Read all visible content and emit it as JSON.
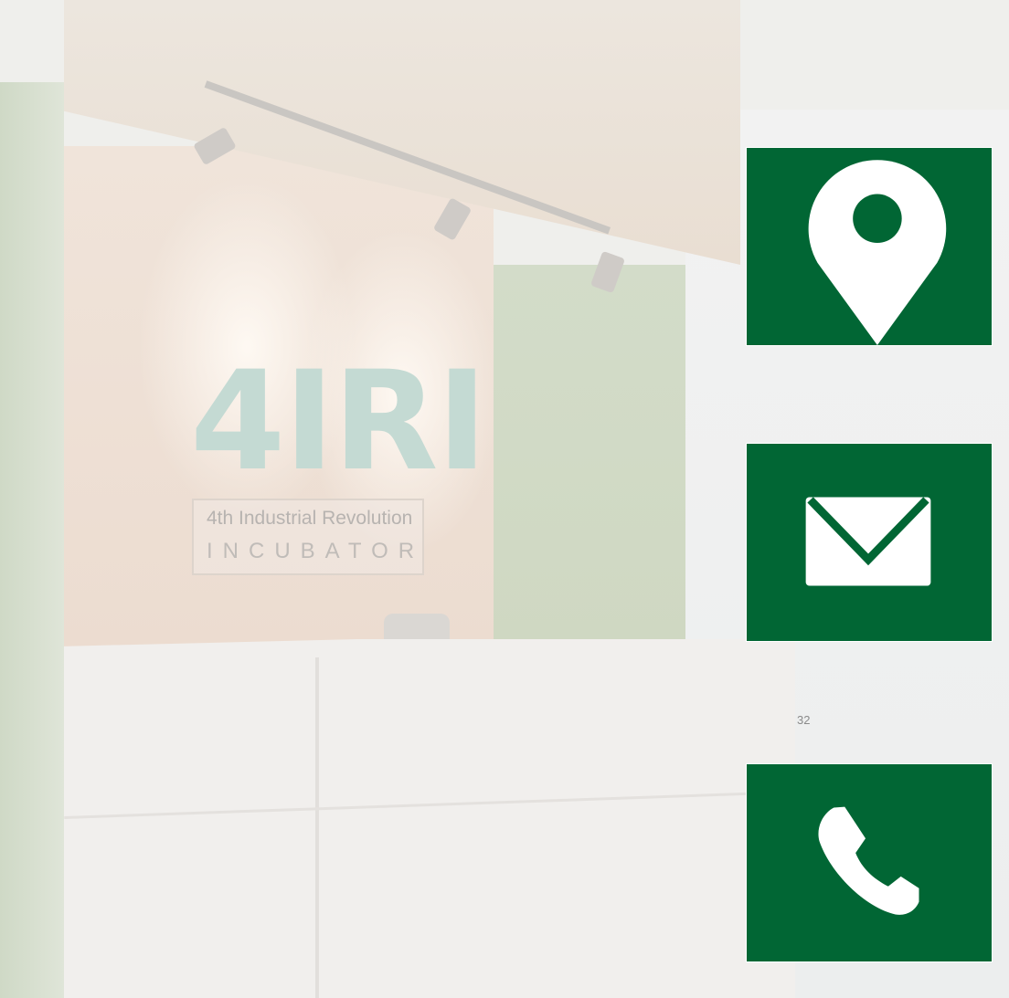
{
  "slide": {
    "page_number": "32",
    "background": {
      "sign": {
        "logo_text": "4IRI",
        "line1": "4th Industrial Revolution",
        "line2": "INCUBATOR"
      }
    },
    "contact_tiles": [
      {
        "icon": "location-pin-icon"
      },
      {
        "icon": "envelope-icon"
      },
      {
        "icon": "phone-icon"
      }
    ]
  },
  "colors": {
    "tile_green": "#016634",
    "icon_white": "#ffffff",
    "page_number_gray": "#8a8a8a"
  }
}
